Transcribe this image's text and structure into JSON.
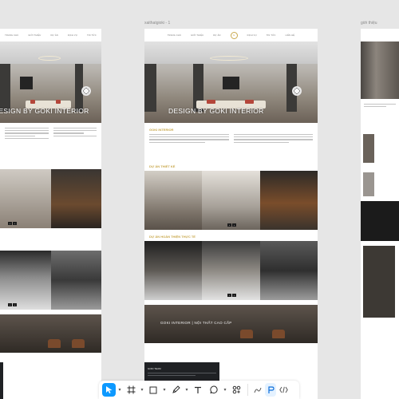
{
  "canvas": {
    "frames": [
      {
        "label": "",
        "position": "left"
      },
      {
        "label": "xaithatgioki - 1",
        "position": "middle"
      },
      {
        "label": "giới thiệu",
        "position": "right"
      }
    ]
  },
  "site": {
    "nav_left": [
      "TRANG CHỦ",
      "GIỚI THIỆU",
      "DỰ ÁN"
    ],
    "nav_right": [
      "DỊCH VỤ",
      "TIN TỨC",
      "LIÊN HỆ"
    ],
    "hero_caption": "DESIGN BY GOKI INTERIOR",
    "intro_heading": "GOKI INTERIOR",
    "section_design": "DỰ ÁN THIẾT KẾ",
    "section_built": "DỰ ÁN HOÀN THIỆN THỰC TẾ",
    "banner_caption": "GOKI INTERIOR | NỘI THẤT CAO CẤP",
    "team_label": "GOKI TEAM"
  },
  "toolbar": {
    "tools": [
      {
        "name": "move-tool",
        "icon": "cursor-icon",
        "active": true
      },
      {
        "name": "frame-tool",
        "icon": "frame-icon",
        "active": false
      },
      {
        "name": "shape-tool",
        "icon": "rectangle-icon",
        "active": false
      },
      {
        "name": "pen-tool",
        "icon": "pen-icon",
        "active": false
      },
      {
        "name": "text-tool",
        "icon": "text-icon",
        "active": false
      },
      {
        "name": "comment-tool",
        "icon": "comment-icon",
        "active": false
      },
      {
        "name": "actions-tool",
        "icon": "actions-icon",
        "active": false
      }
    ],
    "modes": [
      {
        "name": "draw-mode",
        "icon": "draw-icon"
      },
      {
        "name": "design-mode",
        "icon": "design-icon",
        "active": true
      },
      {
        "name": "dev-mode",
        "icon": "code-icon"
      }
    ],
    "accent": "#0d99ff"
  },
  "colors": {
    "canvas_bg": "#e6e6e6",
    "gold": "#c9a84c",
    "dark": "#1f2124"
  }
}
